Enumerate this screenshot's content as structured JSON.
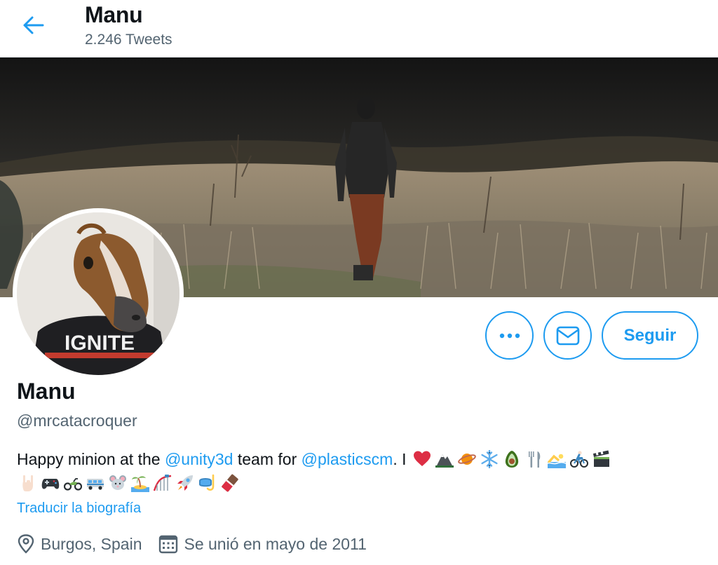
{
  "header": {
    "title": "Manu",
    "tweet_count": "2.246 Tweets"
  },
  "profile": {
    "name": "Manu",
    "handle": "@mrcatacroquer",
    "avatar_shirt_text": "IGNITE",
    "bio": {
      "part1": "Happy minion at the ",
      "mention1": "@unity3d",
      "part2": " team for ",
      "mention2": "@plasticscm",
      "part3": ".  I ",
      "emoji_line1": [
        "heart",
        "mountain",
        "planet",
        "snowflake",
        "avocado",
        "fork-knife",
        "swimmer",
        "cyclist",
        "clapper-board"
      ],
      "emoji_line2": [
        "rock-hand",
        "game-controller",
        "motorcycle",
        "minibus",
        "mouse",
        "island",
        "roller-coaster",
        "rocket",
        "snorkel-mask",
        "chocolate-bar"
      ]
    },
    "translate_label": "Traducir la biografía",
    "location": "Burgos, Spain",
    "joined": "Se unió en mayo de 2011"
  },
  "actions": {
    "more_icon": "more-icon",
    "message_icon": "mail-icon",
    "follow_label": "Seguir"
  },
  "colors": {
    "accent": "#1d9bf0",
    "text_primary": "#0f1419",
    "text_secondary": "#536471"
  }
}
